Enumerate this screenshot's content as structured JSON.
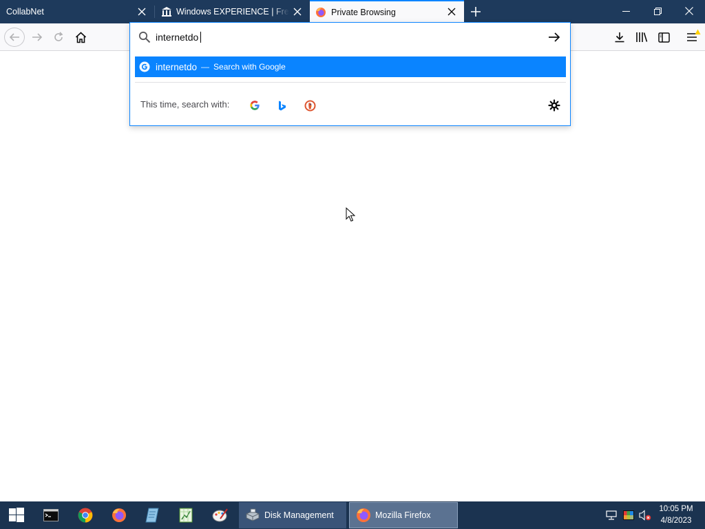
{
  "tabs": [
    {
      "title": "CollabNet",
      "active": false
    },
    {
      "title": "Windows EXPERIENCE | Freestyle",
      "favicon": "museum-icon",
      "active": false
    },
    {
      "title": "Private Browsing",
      "favicon": "firefox-icon",
      "active": true
    }
  ],
  "navbar": {
    "icons": [
      "back-icon",
      "forward-icon",
      "reload-icon",
      "home-icon",
      "download-icon",
      "library-icon",
      "sidebar-icon",
      "menu-icon"
    ]
  },
  "urlbar": {
    "value": "internetdo",
    "suggestion": {
      "text": "internetdo",
      "separator": "—",
      "action": "Search with Google"
    },
    "one_off_label": "This time, search with:",
    "engines": [
      "Google",
      "Bing",
      "DuckDuckGo"
    ]
  },
  "taskbar": {
    "pinned": [
      "start-icon",
      "command-prompt-icon",
      "chrome-icon",
      "firefox-icon",
      "notepad-icon",
      "spreadsheet-icon",
      "paint-icon"
    ],
    "apps": [
      {
        "label": "Disk Management",
        "icon": "disk-management-icon",
        "active": false
      },
      {
        "label": "Mozilla Firefox",
        "icon": "firefox-icon",
        "active": true
      }
    ],
    "clock": {
      "time": "10:05 PM",
      "date": "4/8/2023"
    }
  },
  "colors": {
    "titlebar": "#1e3a5c",
    "accent": "#0a84ff",
    "taskbar": "#1b3350"
  }
}
